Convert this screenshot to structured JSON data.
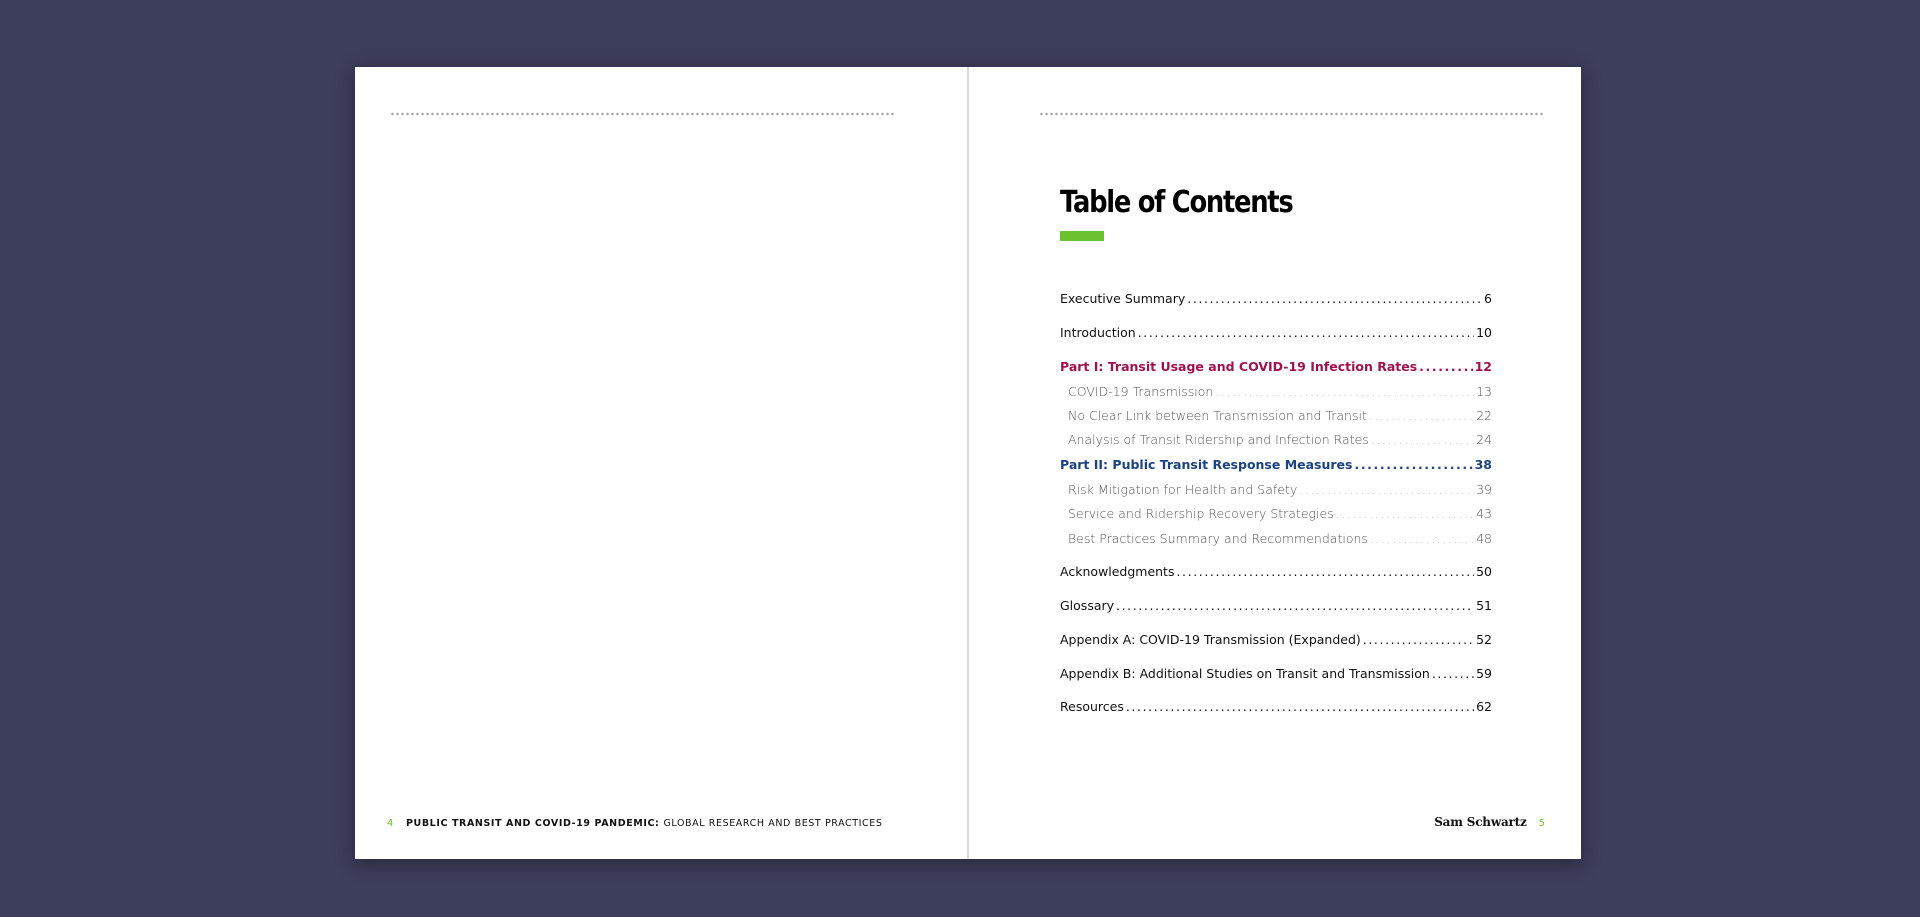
{
  "left_page": {
    "page_number": "4",
    "running_title_bold": "PUBLIC TRANSIT AND COVID-19 PANDEMIC:",
    "running_title_regular": "GLOBAL RESEARCH AND BEST PRACTICES"
  },
  "right_page": {
    "page_number": "5",
    "brand": "Sam Schwartz",
    "title": "Table of Contents",
    "colors": {
      "accent_green": "#6cc12f",
      "part1": "#a0114e",
      "part2": "#1c4282"
    },
    "toc": [
      {
        "label": "Executive Summary",
        "page": "6",
        "level": "main"
      },
      {
        "label": "Introduction",
        "page": "10",
        "level": "main"
      },
      {
        "label": "Part I: Transit Usage and COVID-19 Infection Rates",
        "page": "12",
        "level": "part1"
      },
      {
        "label": "COVID-19 Transmission",
        "page": "13",
        "level": "sub"
      },
      {
        "label": "No Clear Link between Transmission and Transit",
        "page": "22",
        "level": "sub"
      },
      {
        "label": "Analysis of Transit Ridership and Infection Rates",
        "page": "24",
        "level": "sub"
      },
      {
        "label": "Part II: Public Transit Response Measures",
        "page": "38",
        "level": "part2"
      },
      {
        "label": "Risk Mitigation for Health and Safety",
        "page": "39",
        "level": "sub"
      },
      {
        "label": "Service and Ridership Recovery Strategies",
        "page": "43",
        "level": "sub"
      },
      {
        "label": "Best Practices Summary and Recommendations",
        "page": "48",
        "level": "sub"
      },
      {
        "label": "Acknowledgments",
        "page": "50",
        "level": "main"
      },
      {
        "label": "Glossary",
        "page": "51",
        "level": "main"
      },
      {
        "label": "Appendix A: COVID-19 Transmission (Expanded)",
        "page": "52",
        "level": "main"
      },
      {
        "label": "Appendix B: Additional Studies on Transit and Transmission",
        "page": "59",
        "level": "main"
      },
      {
        "label": "Resources",
        "page": "62",
        "level": "main"
      }
    ]
  }
}
